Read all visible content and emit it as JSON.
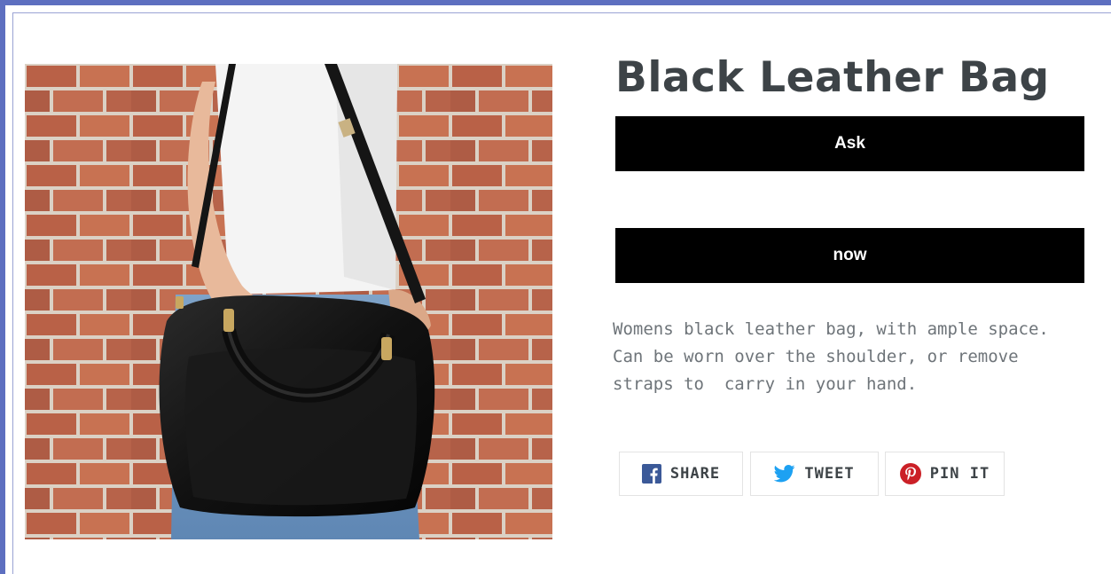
{
  "product": {
    "title": "Black Leather Bag",
    "image_alt": "Woman carrying a black leather bag in front of a brick wall",
    "ask_button_label": "Ask",
    "now_button_label": "now",
    "description_lines": [
      "Womens black leather bag, with ample space.",
      "Can be worn over the shoulder, or remove",
      "straps to  carry in your hand."
    ]
  },
  "share": {
    "facebook_label": "SHARE",
    "twitter_label": "TWEET",
    "pinterest_label": "PIN IT",
    "facebook_icon": "facebook-icon",
    "twitter_icon": "twitter-icon",
    "pinterest_icon": "pinterest-icon"
  },
  "colors": {
    "frame_accent": "#5d6fc0",
    "title_text": "#3d4347",
    "button_bg": "#000000",
    "button_text": "#ffffff",
    "description_text": "#6e7479",
    "facebook_blue": "#3b5998",
    "twitter_blue": "#1da1f2",
    "pinterest_red": "#cb2027"
  }
}
